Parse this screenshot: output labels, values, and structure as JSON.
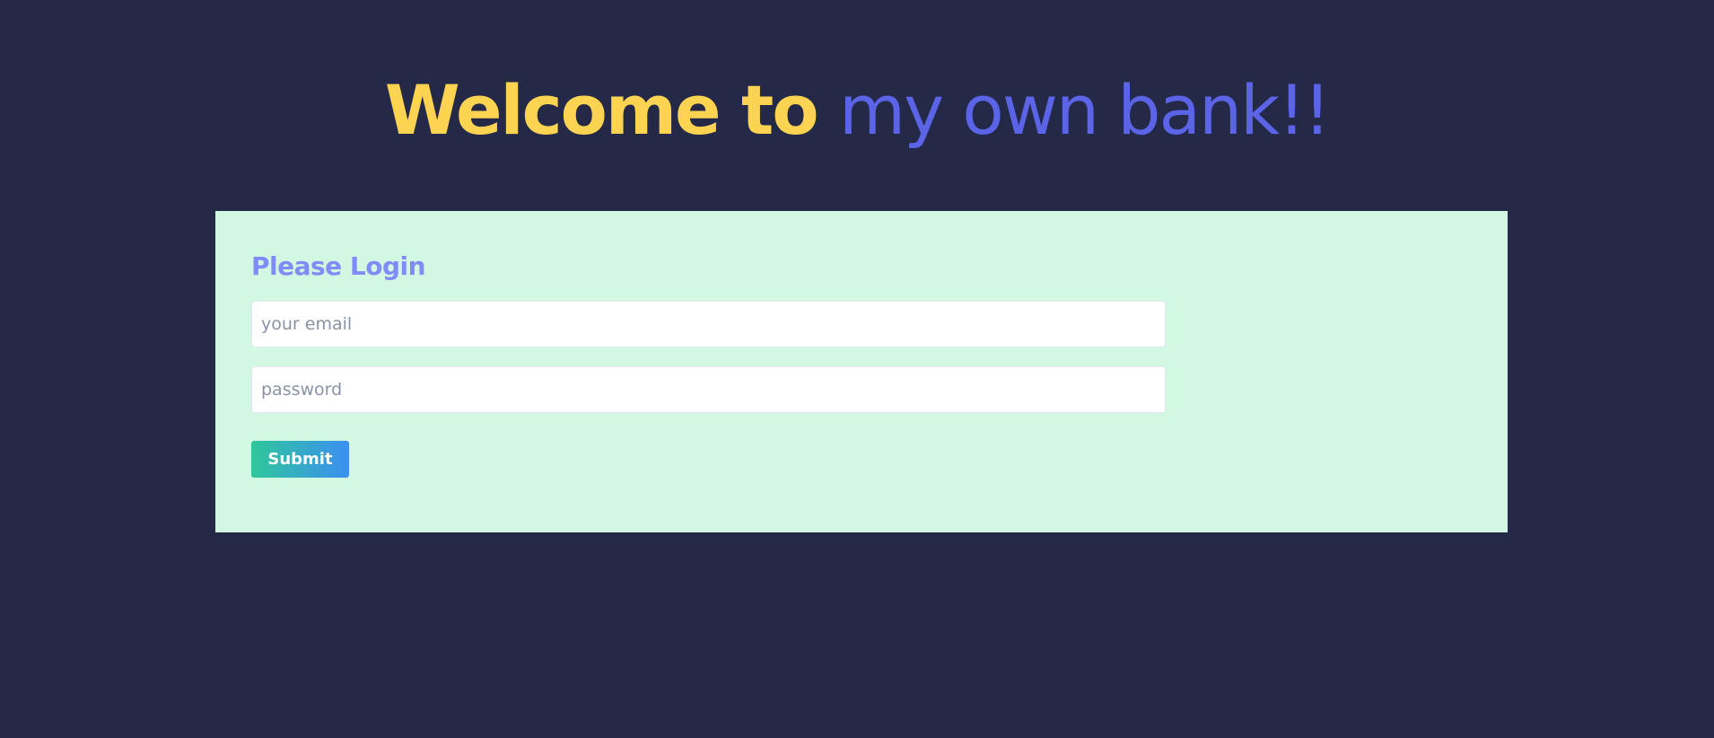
{
  "header": {
    "title_lead": "Welcome to",
    "title_tail": "my own bank!!"
  },
  "login": {
    "heading": "Please Login",
    "email_placeholder": "your email",
    "email_value": "",
    "password_placeholder": "password",
    "password_value": "",
    "submit_label": "Submit"
  },
  "colors": {
    "page_background": "#242947",
    "title_lead": "#fdd451",
    "title_tail": "#5b63e6",
    "panel_background": "#d2f8e4",
    "heading": "#818cf8",
    "button_gradient_start": "#2fc79a",
    "button_gradient_end": "#3b8ff2"
  }
}
